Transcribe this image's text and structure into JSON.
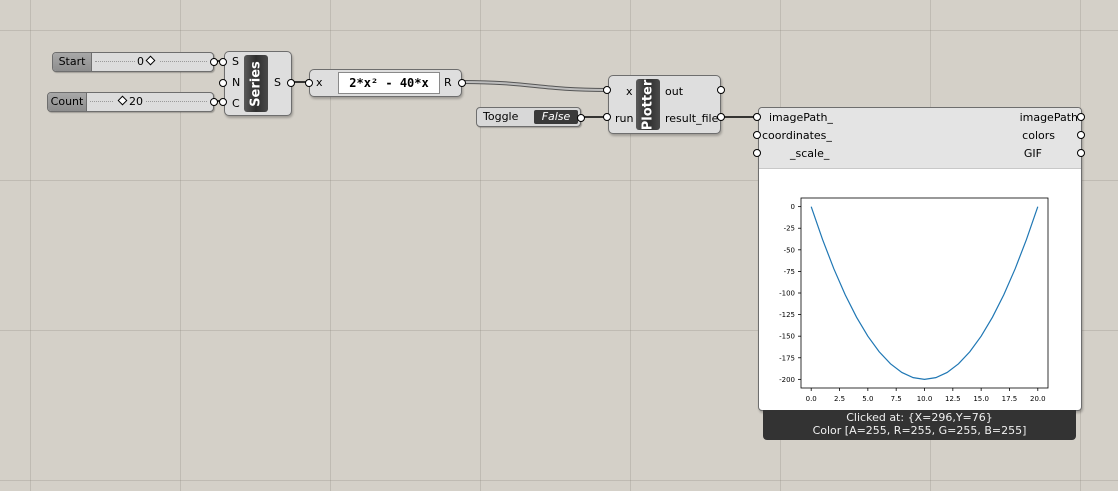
{
  "sliders": {
    "start": {
      "label": "Start",
      "value": "0"
    },
    "count": {
      "label": "Count",
      "value": "20"
    }
  },
  "series": {
    "title": "Series",
    "inputs": [
      "S",
      "N",
      "C"
    ],
    "output": "S"
  },
  "expression": {
    "input": "x",
    "formula": "2*x² - 40*x",
    "output": "R"
  },
  "toggle": {
    "label": "Toggle",
    "value": "False"
  },
  "plotter": {
    "title": "Plotter",
    "inputs": [
      "x",
      "run"
    ],
    "outputs": [
      "out",
      "result_file"
    ]
  },
  "viewer": {
    "inputs": [
      "imagePath_",
      "coordinates_",
      "_scale_"
    ],
    "outputs": [
      "imagePath",
      "colors",
      "GIF"
    ],
    "status_line1": "Clicked at: {X=296,Y=76}",
    "status_line2": "Color [A=255, R=255, G=255, B=255]"
  },
  "colors": {
    "canvas": "#d4d0c8",
    "line": "#1f77b4",
    "component_body": "#3a3a3a"
  },
  "chart_data": {
    "type": "line",
    "title": "",
    "xlabel": "",
    "ylabel": "",
    "xlim": [
      -0.9,
      20.9
    ],
    "ylim": [
      -210,
      10
    ],
    "xticks": [
      "0.0",
      "2.5",
      "5.0",
      "7.5",
      "10.0",
      "12.5",
      "15.0",
      "17.5",
      "20.0"
    ],
    "yticks": [
      "0",
      "-25",
      "-50",
      "-75",
      "-100",
      "-125",
      "-150",
      "-175",
      "-200"
    ],
    "x": [
      0,
      1,
      2,
      3,
      4,
      5,
      6,
      7,
      8,
      9,
      10,
      11,
      12,
      13,
      14,
      15,
      16,
      17,
      18,
      19,
      20
    ],
    "y": [
      0,
      -38,
      -72,
      -102,
      -128,
      -150,
      -168,
      -182,
      -192,
      -198,
      -200,
      -198,
      -192,
      -182,
      -168,
      -150,
      -128,
      -102,
      -72,
      -38,
      0
    ],
    "grid": false
  }
}
